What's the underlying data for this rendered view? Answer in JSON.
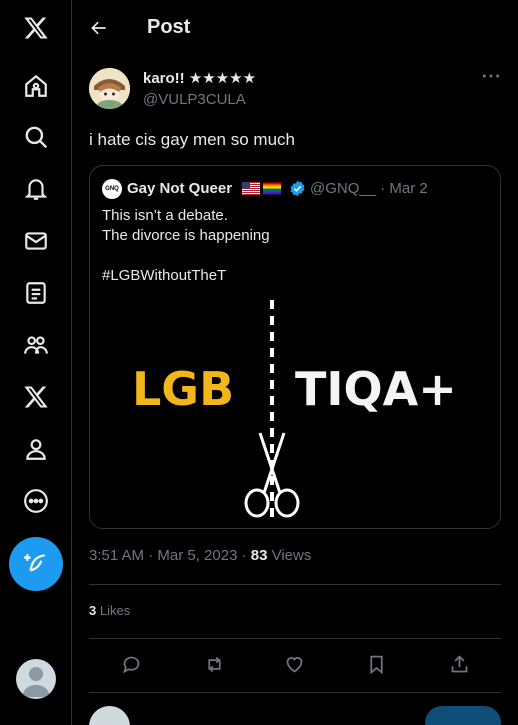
{
  "header": {
    "title": "Post"
  },
  "sidebar": {
    "icons": [
      "x-logo-icon",
      "home-icon",
      "search-icon",
      "bell-icon",
      "mail-icon",
      "lists-icon",
      "communities-icon",
      "x-premium-icon",
      "profile-icon",
      "more-circle-icon"
    ],
    "compose_icon": "feather-plus-icon"
  },
  "post": {
    "author_name": "karo!! ★★★★★",
    "author_handle": "@VULP3CULA",
    "text": "i hate cis gay men so much",
    "quote": {
      "avatar_text": "GNQ",
      "name": "Gay Not Queer",
      "flags": [
        "us-flag",
        "rainbow-flag"
      ],
      "handle_date": "@GNQ__ · Mar 2",
      "line1": "This isn’t a debate.",
      "line2": "The divorce is happening",
      "hashtag": "#LGBWithoutTheT",
      "image": {
        "left_text": "LGB",
        "right_text": "TIQA+",
        "left_color": "#f2b51a"
      }
    },
    "timestamp": "3:51 AM · Mar 5, 2023 · ",
    "views_count": "83",
    "views_label": " Views",
    "likes_count": "3",
    "likes_label": " Likes"
  },
  "colors": {
    "accent": "#1d9bf0",
    "bg": "#000000",
    "border": "#2f3336",
    "muted": "#71767b"
  }
}
